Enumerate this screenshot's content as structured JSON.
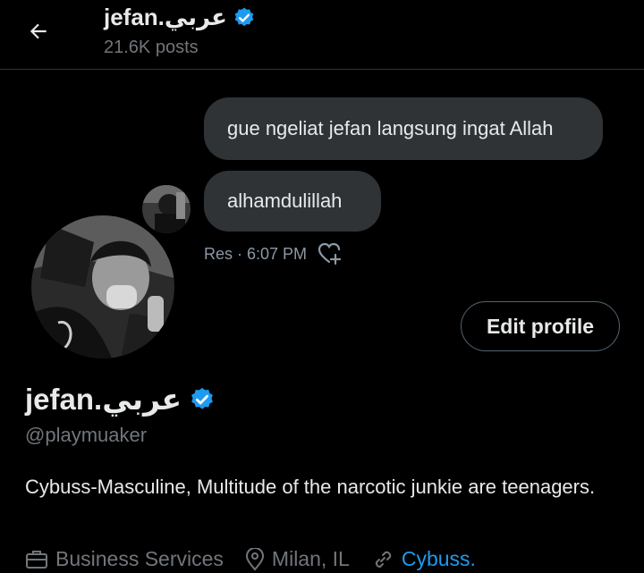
{
  "header": {
    "title": "jefan.عربي",
    "posts_count": "21.6K posts"
  },
  "tweet": {
    "message1": "gue ngeliat jefan langsung ingat Allah",
    "message2": "alhamdulillah",
    "meta": "Res · 6:07 PM"
  },
  "profile": {
    "edit_label": "Edit profile",
    "name": "jefan.عربي",
    "handle": "@playmuaker",
    "bio": "Cybuss-Masculine, Multitude of the narcotic junkie are teenagers.",
    "category": "Business Services",
    "location": "Milan, IL",
    "website": "Cybuss."
  },
  "colors": {
    "accent": "#1d9bf0",
    "background": "#000000",
    "bubble": "#2f3336",
    "muted": "#71767b"
  },
  "icons": [
    "back-arrow-icon",
    "verified-badge-icon",
    "heart-plus-icon",
    "briefcase-icon",
    "location-pin-icon",
    "link-icon"
  ]
}
